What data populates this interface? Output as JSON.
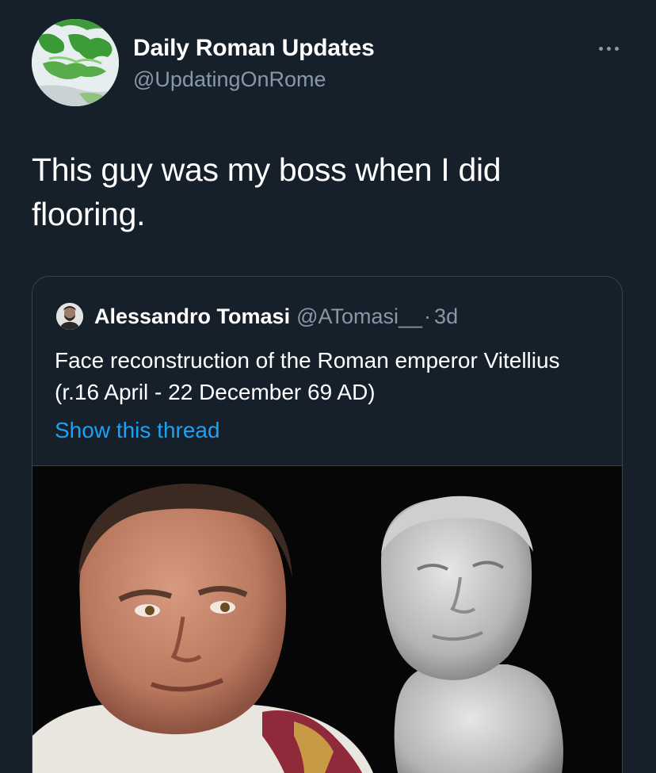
{
  "tweet": {
    "author_name": "Daily Roman Updates",
    "author_handle": "@UpdatingOnRome",
    "avatar_icon": "roman-empire-map-icon",
    "more_icon": "more-options-icon",
    "text": "This guy was my boss when I did flooring."
  },
  "quoted_tweet": {
    "author_name": "Alessandro Tomasi",
    "author_handle": "@ATomasi__",
    "separator": "·",
    "timestamp": "3d",
    "text": "Face reconstruction of the Roman emperor Vitellius (r.16 April - 22 December 69 AD)",
    "link_text": "Show this thread",
    "media_alt": "reconstructed face of emperor Vitellius beside marble bust"
  },
  "colors": {
    "background": "#15202b",
    "secondary_text": "#8899a6",
    "link": "#1da1f2",
    "border": "#38444d"
  }
}
